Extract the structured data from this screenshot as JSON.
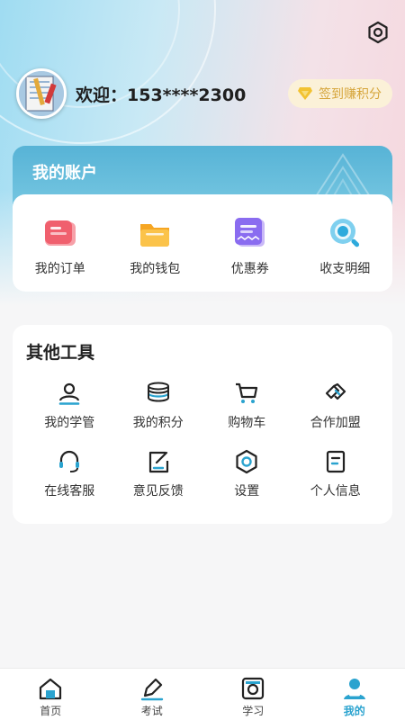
{
  "header": {
    "welcome_text": "欢迎：153****2300",
    "signin_label": "签到赚积分"
  },
  "account": {
    "title": "我的账户",
    "items": [
      {
        "label": "我的订单",
        "icon": "order-icon"
      },
      {
        "label": "我的钱包",
        "icon": "wallet-icon"
      },
      {
        "label": "优惠券",
        "icon": "coupon-icon"
      },
      {
        "label": "收支明细",
        "icon": "search-details-icon"
      }
    ]
  },
  "tools": {
    "title": "其他工具",
    "items": [
      {
        "label": "我的学管",
        "icon": "user-manager-icon"
      },
      {
        "label": "我的积分",
        "icon": "points-stack-icon"
      },
      {
        "label": "购物车",
        "icon": "cart-icon"
      },
      {
        "label": "合作加盟",
        "icon": "handshake-icon"
      },
      {
        "label": "在线客服",
        "icon": "headset-icon"
      },
      {
        "label": "意见反馈",
        "icon": "feedback-icon"
      },
      {
        "label": "设置",
        "icon": "settings-icon"
      },
      {
        "label": "个人信息",
        "icon": "profile-doc-icon"
      }
    ]
  },
  "tabbar": {
    "active_color": "#2aa3cf",
    "items": [
      {
        "label": "首页",
        "icon": "home-icon"
      },
      {
        "label": "考试",
        "icon": "exam-pen-icon"
      },
      {
        "label": "学习",
        "icon": "study-icon"
      },
      {
        "label": "我的",
        "icon": "user-icon"
      }
    ]
  },
  "colors": {
    "accent": "#2aa3cf",
    "account_header": "#57b3d6",
    "signin_text": "#d6a53b"
  }
}
